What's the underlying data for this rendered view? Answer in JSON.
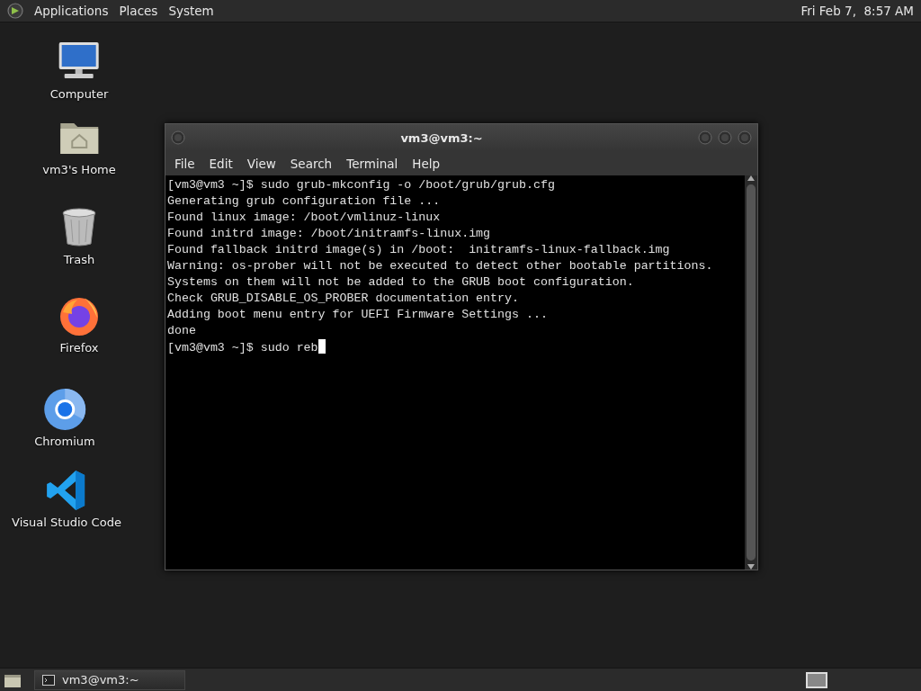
{
  "top_panel": {
    "menus": [
      "Applications",
      "Places",
      "System"
    ],
    "clock": "Fri Feb 7,  8:57 AM"
  },
  "desktop_icons": [
    {
      "label": "Computer",
      "kind": "computer"
    },
    {
      "label": "vm3's Home",
      "kind": "home"
    },
    {
      "label": "Trash",
      "kind": "trash"
    },
    {
      "label": "Firefox",
      "kind": "firefox"
    },
    {
      "label": "Chromium",
      "kind": "chromium"
    },
    {
      "label": "Visual Studio Code",
      "kind": "vscode"
    }
  ],
  "window": {
    "title": "vm3@vm3:~",
    "menu": [
      "File",
      "Edit",
      "View",
      "Search",
      "Terminal",
      "Help"
    ],
    "terminal_lines": [
      "[vm3@vm3 ~]$ sudo grub-mkconfig -o /boot/grub/grub.cfg",
      "Generating grub configuration file ...",
      "Found linux image: /boot/vmlinuz-linux",
      "Found initrd image: /boot/initramfs-linux.img",
      "Found fallback initrd image(s) in /boot:  initramfs-linux-fallback.img",
      "Warning: os-prober will not be executed to detect other bootable partitions.",
      "Systems on them will not be added to the GRUB boot configuration.",
      "Check GRUB_DISABLE_OS_PROBER documentation entry.",
      "Adding boot menu entry for UEFI Firmware Settings ...",
      "done"
    ],
    "prompt_line": "[vm3@vm3 ~]$ sudo reb"
  },
  "bottom_panel": {
    "task": "vm3@vm3:~"
  }
}
